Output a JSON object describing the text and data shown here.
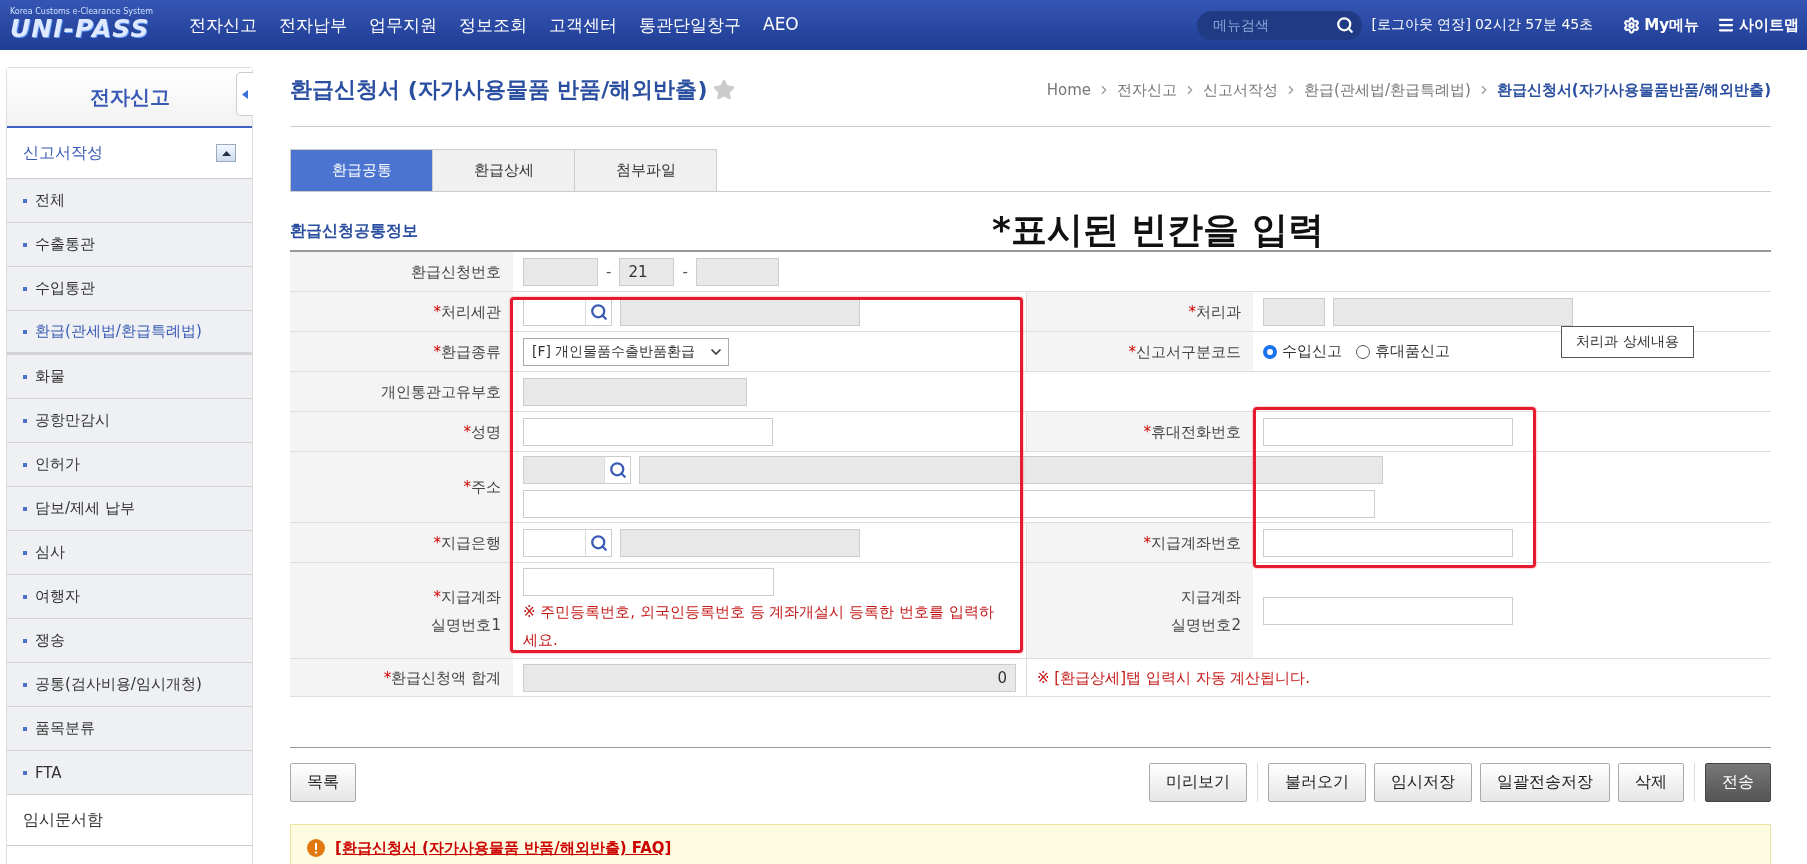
{
  "header": {
    "logo": "UNI-PASS",
    "logo_subtitle": "Korea Customs e-Clearance System",
    "nav": [
      "전자신고",
      "전자납부",
      "업무지원",
      "정보조회",
      "고객센터",
      "통관단일창구",
      "AEO"
    ],
    "search": {
      "placeholder": "메뉴검색"
    },
    "session_link": "[로그아웃 연장]",
    "session_time": "02시간 57분 45초",
    "my_menu": "My메뉴",
    "sitemap": "사이트맵"
  },
  "sidebar": {
    "title": "전자신고",
    "section": {
      "label": "신고서작성",
      "expanded": true
    },
    "items": [
      {
        "label": "전체",
        "selected": false
      },
      {
        "label": "수출통관",
        "selected": false
      },
      {
        "label": "수입통관",
        "selected": false
      },
      {
        "label": "환급(관세법/환급특례법)",
        "selected": true
      },
      {
        "label": "화물",
        "selected": false
      },
      {
        "label": "공항만감시",
        "selected": false
      },
      {
        "label": "인허가",
        "selected": false
      },
      {
        "label": "담보/제세 납부",
        "selected": false
      },
      {
        "label": "심사",
        "selected": false
      },
      {
        "label": "여행자",
        "selected": false
      },
      {
        "label": "쟁송",
        "selected": false
      },
      {
        "label": "공통(검사비용/임시개청)",
        "selected": false
      },
      {
        "label": "품목분류",
        "selected": false
      },
      {
        "label": "FTA",
        "selected": false
      }
    ],
    "footer_item": "임시문서함"
  },
  "page": {
    "title": "환급신청서 (자가사용물품 반품/해외반출)",
    "favorite": false,
    "breadcrumb": [
      "Home",
      "전자신고",
      "신고서작성",
      "환급(관세법/환급특례법)",
      "환급신청서(자가사용물품반품/해외반출)"
    ]
  },
  "tabs": [
    {
      "label": "환급공통",
      "selected": true
    },
    {
      "label": "환급상세",
      "selected": false
    },
    {
      "label": "첨부파일",
      "selected": false
    }
  ],
  "section_title": "환급신청공통정보",
  "annotation": "*표시된 빈칸을 입력",
  "form": [
    {
      "left": {
        "label": [
          "환급신청번호"
        ],
        "kind": "number",
        "middle_value": "21",
        "separators": [
          "-",
          "-"
        ]
      }
    },
    {
      "left": {
        "label": [
          "처리세관"
        ],
        "required_mark": "*",
        "kind": "lookup"
      },
      "right": {
        "label": [
          "처리과"
        ],
        "required_mark": "*",
        "kind": "codename"
      }
    },
    {
      "left": {
        "label": [
          "환급종류"
        ],
        "required_mark": "*",
        "kind": "select",
        "value": "[F] 개인물품수출반품환급"
      },
      "right": {
        "label": [
          "신고서구분코드"
        ],
        "required_mark": "*",
        "kind": "radio",
        "options": [
          {
            "label": "수입신고",
            "selected": true
          },
          {
            "label": "휴대품신고",
            "selected": false
          }
        ]
      }
    },
    {
      "left": {
        "label": [
          "개인통관고유부호"
        ],
        "kind": "readonly"
      }
    },
    {
      "left": {
        "label": [
          "성명"
        ],
        "required_mark": "*",
        "kind": "text"
      },
      "right": {
        "label": [
          "휴대전화번호"
        ],
        "required_mark": "*",
        "kind": "text"
      }
    },
    {
      "left": {
        "label": [
          "주소"
        ],
        "required_mark": "*",
        "kind": "address"
      }
    },
    {
      "left": {
        "label": [
          "지급은행"
        ],
        "required_mark": "*",
        "kind": "lookup"
      },
      "right": {
        "label": [
          "지급계좌번호"
        ],
        "required_mark": "*",
        "kind": "text"
      }
    },
    {
      "left": {
        "label": [
          "지급계좌",
          "실명번호1"
        ],
        "required_mark": "*",
        "kind": "textnote",
        "note": "※ 주민등록번호, 외국인등록번호 등 계좌개설시 등록한 번호를 입력하세요."
      },
      "right": {
        "label": [
          "지급계좌",
          "실명번호2"
        ],
        "kind": "text"
      }
    },
    {
      "left": {
        "label": [
          "환급신청액 합계"
        ],
        "required_mark": "*",
        "kind": "sum",
        "value": "0"
      },
      "right": {
        "kind": "note",
        "note": "※ [환급상세]탭 입력시 자동 계산됩니다."
      }
    }
  ],
  "tooltip": "처리과 상세내용",
  "buttons_left": [
    {
      "label": "목록"
    }
  ],
  "buttons_right": [
    {
      "label": "미리보기",
      "kind": "plain",
      "separator_before": false
    },
    {
      "label": "불러오기",
      "kind": "plain",
      "separator_before": true
    },
    {
      "label": "임시저장",
      "kind": "plain",
      "separator_before": false
    },
    {
      "label": "일괄전송저장",
      "kind": "plain",
      "separator_before": false
    },
    {
      "label": "삭제",
      "kind": "plain",
      "separator_before": false
    },
    {
      "label": "전송",
      "kind": "primary",
      "separator_before": true
    }
  ],
  "faq": "[환급신청서 (자가사용물품 반품/해외반출) FAQ]"
}
